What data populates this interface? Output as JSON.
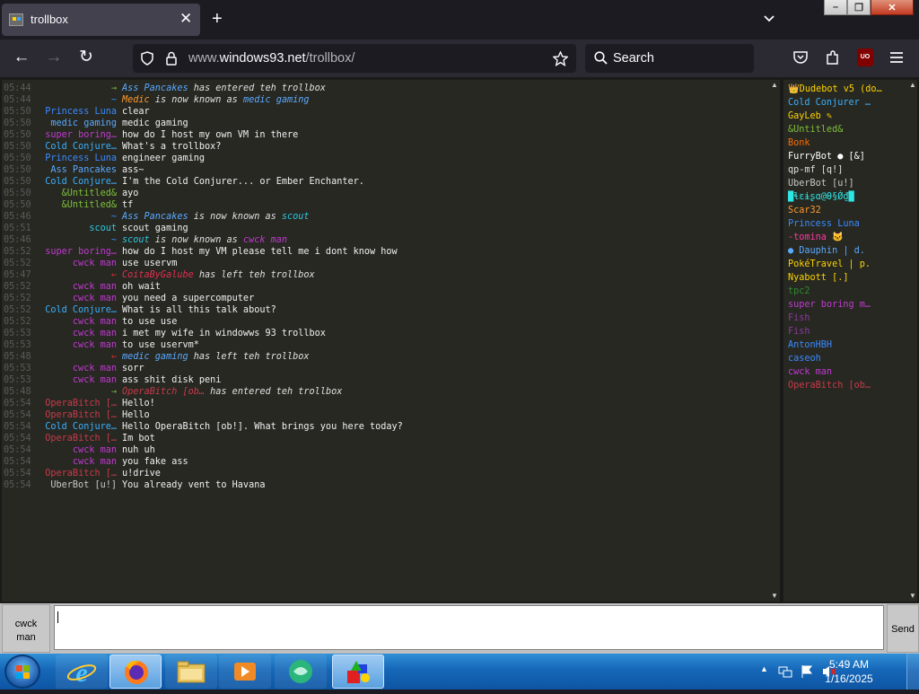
{
  "browser": {
    "tab_title": "trollbox",
    "url_host_dim": "www.",
    "url_host": "windows93.net",
    "url_path": "/trollbox/",
    "search_placeholder": "Search"
  },
  "chat": {
    "messages": [
      {
        "time": "05:44",
        "nick": "→",
        "nick_color": "#7ec03a",
        "text_parts": [
          {
            "t": "Ass Pancakes",
            "c": "#5aa9ff"
          },
          {
            "t": " has entered teh trollbox",
            "c": "#e0e0e0"
          }
        ],
        "system": true
      },
      {
        "time": "05:44",
        "nick": "~",
        "nick_color": "#3a8aff",
        "text_parts": [
          {
            "t": "Medic",
            "c": "#ff9a2e"
          },
          {
            "t": " is now known as ",
            "c": "#e0e0e0"
          },
          {
            "t": "medic gaming",
            "c": "#5aa9ff"
          }
        ],
        "system": true
      },
      {
        "time": "05:50",
        "nick": "Princess Luna",
        "nick_color": "#3a8aff",
        "text": "clear"
      },
      {
        "time": "05:50",
        "nick": "medic gaming",
        "nick_color": "#5aa9ff",
        "text": "medic gaming"
      },
      {
        "time": "05:50",
        "nick": "super boring…",
        "nick_color": "#c03ad0",
        "text": "how do I host my own VM in there"
      },
      {
        "time": "05:50",
        "nick": "Cold Conjure…",
        "nick_color": "#3ab0ff",
        "text": "What's a trollbox?"
      },
      {
        "time": "05:50",
        "nick": "Princess Luna",
        "nick_color": "#3a8aff",
        "text": "engineer gaming"
      },
      {
        "time": "05:50",
        "nick": "Ass Pancakes",
        "nick_color": "#5aa9ff",
        "text": "ass~"
      },
      {
        "time": "05:50",
        "nick": "Cold Conjure…",
        "nick_color": "#3ab0ff",
        "text": "I'm the Cold Conjurer... or Ember Enchanter."
      },
      {
        "time": "05:50",
        "nick": "&Untitled&",
        "nick_color": "#7ec03a",
        "text": "ayo"
      },
      {
        "time": "05:50",
        "nick": "&Untitled&",
        "nick_color": "#7ec03a",
        "text": "tf"
      },
      {
        "time": "05:46",
        "nick": "~",
        "nick_color": "#3a8aff",
        "text_parts": [
          {
            "t": "Ass Pancakes",
            "c": "#5aa9ff"
          },
          {
            "t": " is now known as ",
            "c": "#e0e0e0"
          },
          {
            "t": "scout",
            "c": "#2ec7e0"
          }
        ],
        "system": true
      },
      {
        "time": "05:51",
        "nick": "scout",
        "nick_color": "#2ec7e0",
        "text": "scout gaming"
      },
      {
        "time": "05:46",
        "nick": "~",
        "nick_color": "#3a8aff",
        "text_parts": [
          {
            "t": "scout",
            "c": "#2ec7e0"
          },
          {
            "t": " is now known as ",
            "c": "#e0e0e0"
          },
          {
            "t": "cwck man",
            "c": "#c03ad0"
          }
        ],
        "system": true
      },
      {
        "time": "05:52",
        "nick": "super boring…",
        "nick_color": "#c03ad0",
        "text": "how do I host my VM please tell me i dont know how"
      },
      {
        "time": "05:52",
        "nick": "cwck man",
        "nick_color": "#c03ad0",
        "text": "use uservm"
      },
      {
        "time": "05:47",
        "nick": "←",
        "nick_color": "#e03030",
        "text_parts": [
          {
            "t": "CoitaByGalube",
            "c": "#e03050"
          },
          {
            "t": " has left teh trollbox",
            "c": "#e0e0e0"
          }
        ],
        "system": true
      },
      {
        "time": "05:52",
        "nick": "cwck man",
        "nick_color": "#c03ad0",
        "text": "oh wait"
      },
      {
        "time": "05:52",
        "nick": "cwck man",
        "nick_color": "#c03ad0",
        "text": "you need a supercomputer"
      },
      {
        "time": "05:52",
        "nick": "Cold Conjure…",
        "nick_color": "#3ab0ff",
        "text": "What is all this talk about?"
      },
      {
        "time": "05:52",
        "nick": "cwck man",
        "nick_color": "#c03ad0",
        "text": "to use use"
      },
      {
        "time": "05:53",
        "nick": "cwck man",
        "nick_color": "#c03ad0",
        "text": "i met my wife in windowws 93 trollbox"
      },
      {
        "time": "05:53",
        "nick": "cwck man",
        "nick_color": "#c03ad0",
        "text": "to use uservm*"
      },
      {
        "time": "05:48",
        "nick": "←",
        "nick_color": "#e03030",
        "text_parts": [
          {
            "t": "medic gaming",
            "c": "#5aa9ff"
          },
          {
            "t": " has left teh trollbox",
            "c": "#e0e0e0"
          }
        ],
        "system": true
      },
      {
        "time": "05:53",
        "nick": "cwck man",
        "nick_color": "#c03ad0",
        "text": "sorr"
      },
      {
        "time": "05:53",
        "nick": "cwck man",
        "nick_color": "#c03ad0",
        "text": "ass shit disk peni"
      },
      {
        "time": "05:48",
        "nick": "→",
        "nick_color": "#7ec03a",
        "text_parts": [
          {
            "t": "OperaBitch [ob…",
            "c": "#c83a4a"
          },
          {
            "t": " has entered teh trollbox",
            "c": "#e0e0e0"
          }
        ],
        "system": true
      },
      {
        "time": "05:54",
        "nick": "OperaBitch […",
        "nick_color": "#c83a4a",
        "text": "Hello!"
      },
      {
        "time": "05:54",
        "nick": "OperaBitch […",
        "nick_color": "#c83a4a",
        "text": "Hello"
      },
      {
        "time": "05:54",
        "nick": "Cold Conjure…",
        "nick_color": "#3ab0ff",
        "text": "Hello OperaBitch [ob!]. What brings you here today?"
      },
      {
        "time": "05:54",
        "nick": "OperaBitch […",
        "nick_color": "#c83a4a",
        "text": "Im bot"
      },
      {
        "time": "05:54",
        "nick": "cwck man",
        "nick_color": "#c03ad0",
        "text": "nuh uh"
      },
      {
        "time": "05:54",
        "nick": "cwck man",
        "nick_color": "#c03ad0",
        "text": "you fake ass"
      },
      {
        "time": "05:54",
        "nick": "OperaBitch […",
        "nick_color": "#c83a4a",
        "text": "u!drive"
      },
      {
        "time": "05:54",
        "nick": "UberBot [u!]",
        "nick_color": "#c8c8c8",
        "text": "You already vent to Havana"
      }
    ]
  },
  "users": [
    {
      "name": "👑Dudebot v5 (do…",
      "color": "#ffd400"
    },
    {
      "name": "Cold Conjurer …",
      "color": "#3ab0ff"
    },
    {
      "name": "GayLeb ✎",
      "color": "#ffd400"
    },
    {
      "name": "&Untitled&",
      "color": "#7ec03a"
    },
    {
      "name": "Bonk",
      "color": "#ff6a00"
    },
    {
      "name": "FurryBot ● [&]",
      "color": "#ffffff"
    },
    {
      "name": "qp-mf [q!]",
      "color": "#e0e0e0"
    },
    {
      "name": "UberBot [u!]",
      "color": "#c8c8c8"
    },
    {
      "name": "█ɬɛɨʂɑ@Ɵ§Ǿ₫█",
      "color": "#2ee6e6"
    },
    {
      "name": "Scar32",
      "color": "#ff9a2e"
    },
    {
      "name": "Princess Luna",
      "color": "#3a8aff"
    },
    {
      "name": "-tomina 🐱",
      "color": "#ff3aa0"
    },
    {
      "name": "● Dauphin | d.",
      "color": "#5aa9ff"
    },
    {
      "name": "PokéTravel | p.",
      "color": "#ffd400"
    },
    {
      "name": "Nyabott [.]",
      "color": "#ffd400"
    },
    {
      "name": "tpc2",
      "color": "#2e8a2e"
    },
    {
      "name": "super boring m…",
      "color": "#c03ad0"
    },
    {
      "name": "Fish",
      "color": "#8a3aa0"
    },
    {
      "name": "Fish",
      "color": "#8a3aa0"
    },
    {
      "name": "AntonHBH",
      "color": "#3a8aff"
    },
    {
      "name": "caseoh",
      "color": "#3a8aff"
    },
    {
      "name": "cwck man",
      "color": "#c03ad0"
    },
    {
      "name": "OperaBitch [ob…",
      "color": "#c83a4a"
    }
  ],
  "input": {
    "nick_button": "cwck\nman",
    "message_value": "",
    "send_label": "Send"
  },
  "taskbar": {
    "time": "5:49 AM",
    "date": "1/16/2025"
  }
}
